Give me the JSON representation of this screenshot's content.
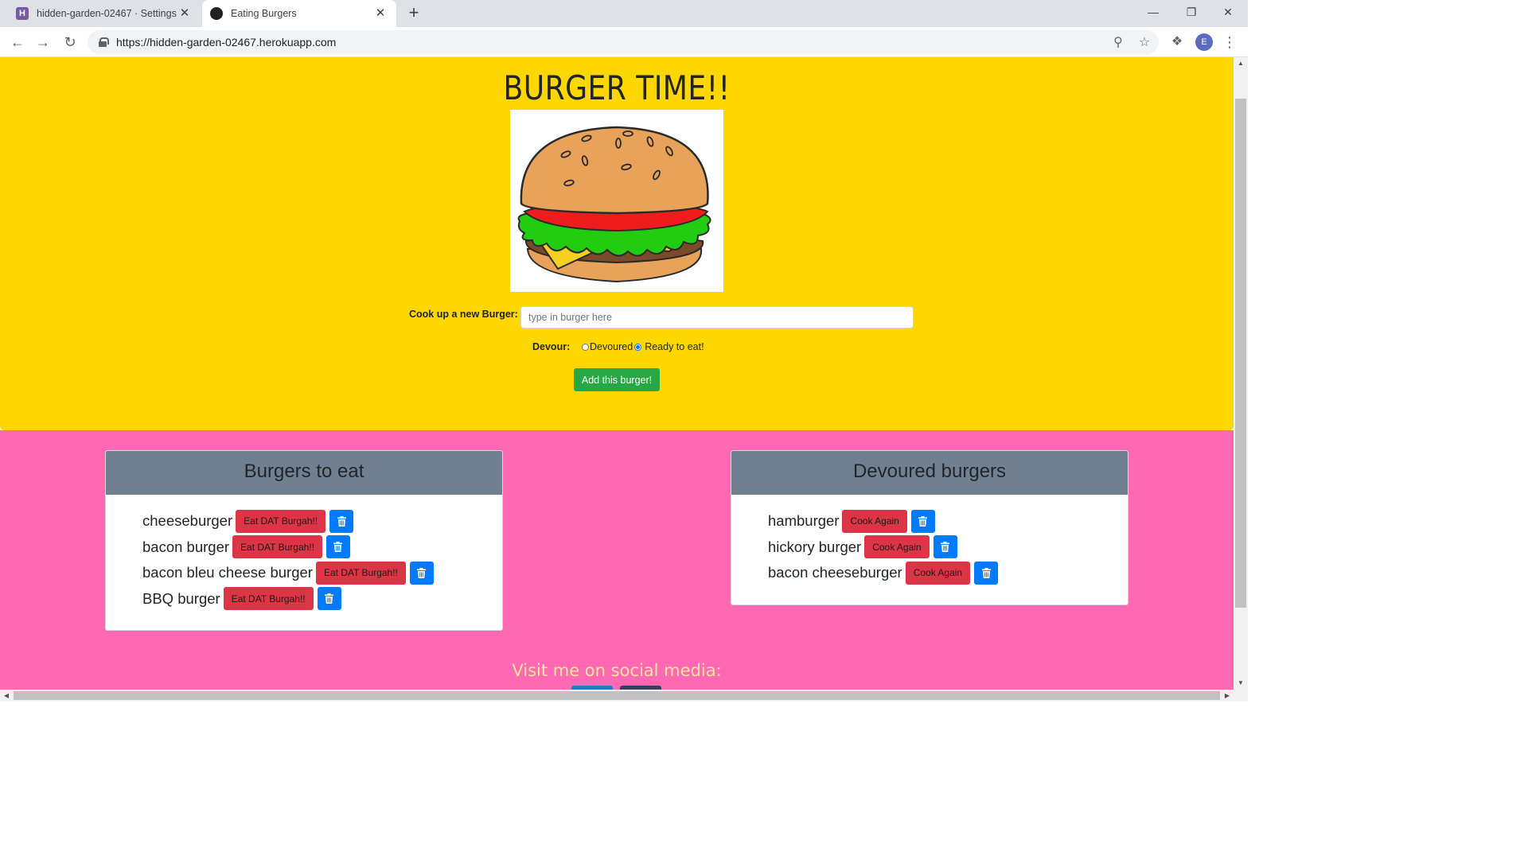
{
  "browser": {
    "tabs": [
      {
        "title": "hidden-garden-02467 · Settings |",
        "favicon": "heroku-icon",
        "favicon_letter": "H"
      },
      {
        "title": "Eating Burgers",
        "favicon": "burger-icon"
      }
    ],
    "url": "https://hidden-garden-02467.herokuapp.com",
    "profile_initial": "E"
  },
  "page": {
    "title": "BURGER TIME!!",
    "form": {
      "cook_label": "Cook up a new Burger:",
      "input_placeholder": "type in burger here",
      "input_value": "",
      "devour_label": "Devour:",
      "radio_options": [
        {
          "label": "Devoured",
          "checked": false
        },
        {
          "label": "Ready to eat!",
          "checked": true
        }
      ],
      "submit_label": "Add this burger!"
    },
    "to_eat": {
      "heading": "Burgers to eat",
      "items": [
        {
          "name": "cheeseburger",
          "action": "Eat DAT Burgah!!"
        },
        {
          "name": "bacon burger",
          "action": "Eat DAT Burgah!!"
        },
        {
          "name": "bacon bleu cheese burger",
          "action": "Eat DAT Burgah!!"
        },
        {
          "name": "BBQ burger",
          "action": "Eat DAT Burgah!!"
        }
      ]
    },
    "devoured": {
      "heading": "Devoured burgers",
      "items": [
        {
          "name": "hamburger",
          "action": "Cook Again"
        },
        {
          "name": "hickory burger",
          "action": "Cook Again"
        },
        {
          "name": "bacon cheeseburger",
          "action": "Cook Again"
        }
      ]
    },
    "social_heading": "Visit me on social media:"
  },
  "colors": {
    "jumbotron_bg": "#ffd700",
    "section_bg": "#ff69b4",
    "card_header_bg": "#708090",
    "add_button": "#28a745",
    "action_button": "#dc3545",
    "delete_button": "#007bff"
  }
}
